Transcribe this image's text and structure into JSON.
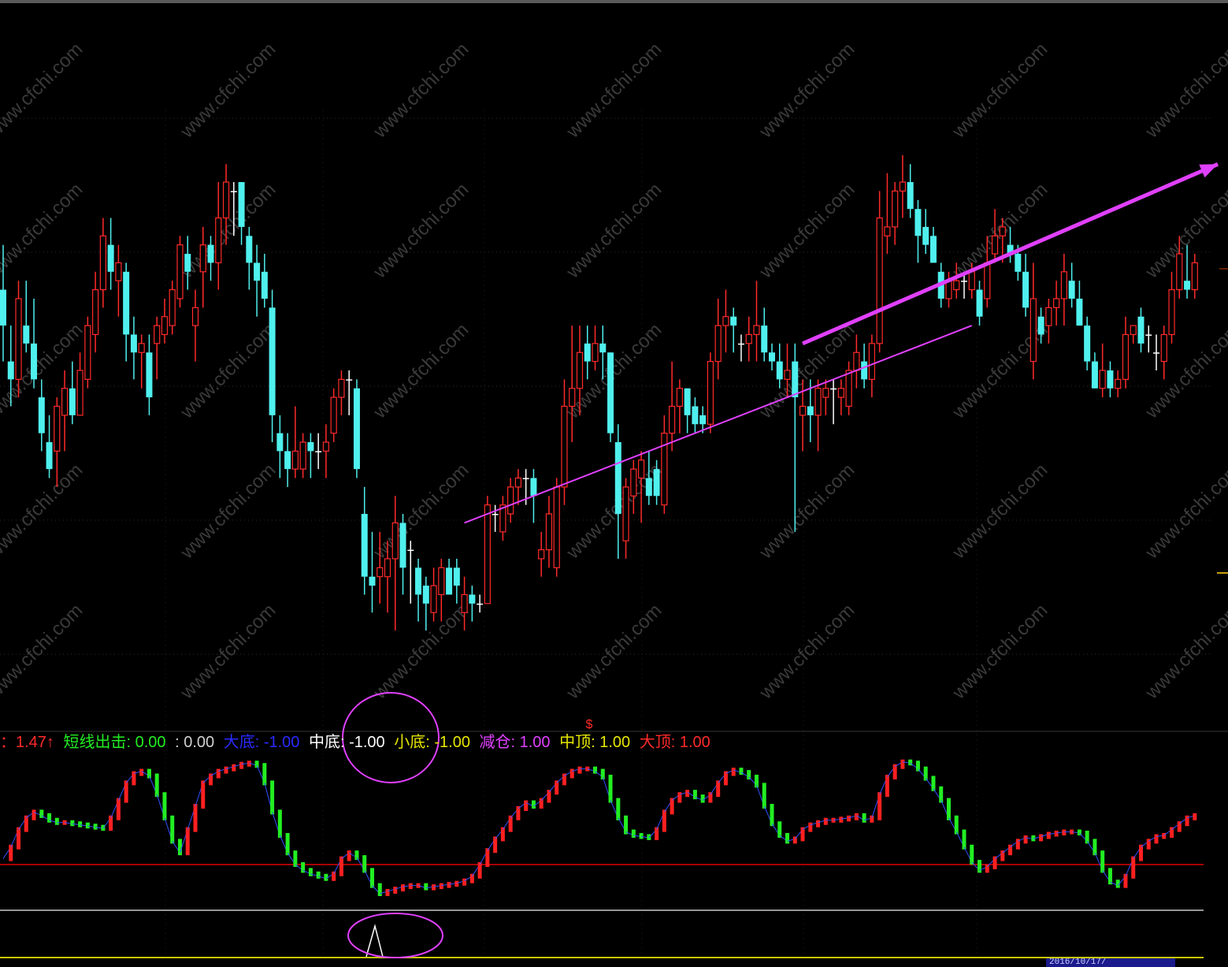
{
  "colors": {
    "background": "#000000",
    "up_candle": "#ff2a2a",
    "down_candle": "#4ff0ee",
    "flat_candle": "#ffffff",
    "trend_arrow": "#e040ff",
    "circle": "#e040ff",
    "osc_up": "#ff2020",
    "osc_down": "#22ee22",
    "zero_line": "#e00000",
    "divider": "#c8c8c8",
    "bottom_line": "#c8c800",
    "watermark": "#3a3a3a"
  },
  "watermark": "www.cfchi.com",
  "legend": [
    {
      "text": "：1.47↑",
      "color": "#ff2a2a"
    },
    {
      "text": "短线出击: 0.00",
      "color": "#22ee22"
    },
    {
      "text": ": 0.00",
      "color": "#d0d0d0"
    },
    {
      "text": "大底: -1.00",
      "color": "#2a2aff"
    },
    {
      "text": "中底: -1.00",
      "color": "#ffffff"
    },
    {
      "text": "小底: -1.00",
      "color": "#e6e600"
    },
    {
      "text": "减仓: 1.00",
      "color": "#e040ff"
    },
    {
      "text": "中顶: 1.00",
      "color": "#e6e600"
    },
    {
      "text": "大顶: 1.00",
      "color": "#ff2a2a"
    }
  ],
  "signal_mark": "$",
  "date_badge": "2016/10/17/",
  "chart_data": [
    {
      "type": "candlestick",
      "title": "",
      "candles": [
        [
          12.0,
          12.5,
          11.2,
          11.6
        ],
        [
          11.2,
          11.6,
          10.7,
          11.0
        ],
        [
          11.0,
          12.1,
          10.8,
          11.9
        ],
        [
          11.6,
          12.1,
          11.3,
          11.4
        ],
        [
          11.4,
          11.9,
          10.9,
          11.0
        ],
        [
          10.8,
          11.0,
          10.2,
          10.4
        ],
        [
          10.3,
          10.6,
          9.9,
          10.0
        ],
        [
          10.2,
          10.8,
          9.8,
          10.7
        ],
        [
          10.6,
          11.1,
          10.2,
          10.9
        ],
        [
          10.9,
          11.2,
          10.5,
          10.6
        ],
        [
          10.6,
          11.3,
          10.6,
          11.1
        ],
        [
          11.0,
          11.7,
          10.9,
          11.6
        ],
        [
          11.5,
          12.2,
          11.3,
          12.0
        ],
        [
          12.0,
          12.8,
          11.8,
          12.6
        ],
        [
          12.5,
          12.8,
          12.0,
          12.2
        ],
        [
          12.1,
          12.5,
          11.7,
          12.3
        ],
        [
          12.2,
          12.3,
          11.2,
          11.5
        ],
        [
          11.5,
          11.7,
          11.0,
          11.3
        ],
        [
          11.3,
          11.5,
          10.9,
          11.4
        ],
        [
          11.3,
          11.5,
          10.6,
          10.8
        ],
        [
          11.4,
          11.7,
          11.0,
          11.6
        ],
        [
          11.5,
          11.9,
          11.4,
          11.7
        ],
        [
          11.6,
          12.1,
          11.5,
          12.0
        ],
        [
          11.9,
          12.6,
          11.8,
          12.5
        ],
        [
          12.4,
          12.6,
          12.0,
          12.2
        ],
        [
          11.6,
          12.0,
          11.2,
          11.8
        ],
        [
          12.2,
          12.7,
          11.8,
          12.5
        ],
        [
          12.5,
          12.6,
          12.1,
          12.3
        ],
        [
          12.3,
          13.2,
          12.0,
          12.8
        ],
        [
          12.8,
          13.4,
          12.5,
          13.2
        ],
        [
          13.1,
          13.2,
          12.6,
          13.1
        ],
        [
          13.2,
          13.2,
          12.5,
          12.7
        ],
        [
          12.6,
          12.7,
          12.0,
          12.3
        ],
        [
          12.3,
          12.5,
          11.7,
          12.1
        ],
        [
          12.2,
          12.4,
          11.8,
          11.9
        ],
        [
          11.8,
          12.0,
          10.3,
          10.6
        ],
        [
          10.4,
          10.6,
          9.9,
          10.2
        ],
        [
          10.2,
          10.4,
          9.8,
          10.0
        ],
        [
          10.0,
          10.7,
          9.9,
          10.2
        ],
        [
          10.0,
          10.4,
          9.9,
          10.3
        ],
        [
          10.3,
          10.4,
          9.9,
          10.2
        ],
        [
          10.2,
          10.4,
          10.0,
          10.2
        ],
        [
          10.2,
          10.5,
          9.9,
          10.3
        ],
        [
          10.4,
          10.9,
          10.3,
          10.8
        ],
        [
          10.8,
          11.1,
          10.6,
          11.0
        ],
        [
          11.0,
          11.1,
          10.6,
          11.0
        ],
        [
          10.9,
          11.0,
          9.9,
          10.0
        ],
        [
          9.5,
          9.8,
          8.6,
          8.8
        ],
        [
          8.8,
          9.3,
          8.4,
          8.7
        ],
        [
          8.8,
          9.3,
          8.5,
          8.9
        ],
        [
          8.8,
          9.2,
          8.4,
          9.0
        ],
        [
          9.0,
          9.7,
          8.2,
          9.4
        ],
        [
          9.4,
          9.5,
          8.6,
          8.9
        ],
        [
          9.1,
          9.2,
          8.5,
          9.1
        ],
        [
          8.9,
          9.0,
          8.3,
          8.6
        ],
        [
          8.7,
          8.8,
          8.2,
          8.5
        ],
        [
          8.4,
          8.9,
          8.3,
          8.7
        ],
        [
          8.6,
          9.0,
          8.3,
          8.9
        ],
        [
          8.9,
          9.0,
          8.6,
          8.6
        ],
        [
          8.9,
          9.0,
          8.5,
          8.7
        ],
        [
          8.4,
          8.8,
          8.2,
          8.6
        ],
        [
          8.6,
          8.7,
          8.3,
          8.5
        ],
        [
          8.5,
          8.6,
          8.4,
          8.5
        ],
        [
          8.5,
          9.7,
          8.5,
          9.6
        ],
        [
          9.5,
          9.6,
          9.3,
          9.5
        ],
        [
          9.3,
          9.7,
          9.2,
          9.6
        ],
        [
          9.5,
          9.9,
          9.4,
          9.8
        ],
        [
          9.8,
          10.0,
          9.6,
          9.9
        ],
        [
          9.9,
          10.0,
          9.6,
          9.9
        ],
        [
          9.9,
          10.0,
          9.4,
          9.7
        ],
        [
          9.0,
          9.3,
          8.8,
          9.1
        ],
        [
          9.1,
          9.7,
          8.9,
          9.5
        ],
        [
          8.9,
          9.9,
          8.8,
          9.8
        ],
        [
          9.8,
          11.0,
          9.6,
          10.7
        ],
        [
          10.7,
          11.6,
          10.3,
          10.9
        ],
        [
          10.9,
          11.6,
          10.6,
          11.3
        ],
        [
          11.4,
          11.6,
          11.0,
          11.2
        ],
        [
          11.2,
          11.6,
          11.1,
          11.4
        ],
        [
          11.4,
          11.6,
          11.0,
          11.3
        ],
        [
          11.3,
          11.3,
          10.3,
          10.4
        ],
        [
          10.3,
          10.5,
          9.0,
          9.5
        ],
        [
          9.2,
          9.9,
          9.0,
          9.8
        ],
        [
          9.7,
          10.1,
          9.5,
          10.0
        ],
        [
          9.9,
          10.2,
          9.4,
          10.1
        ],
        [
          9.9,
          10.2,
          9.6,
          9.7
        ],
        [
          10.0,
          10.1,
          9.6,
          9.7
        ],
        [
          9.6,
          10.6,
          9.5,
          10.4
        ],
        [
          10.4,
          11.2,
          10.2,
          10.7
        ],
        [
          10.7,
          11.0,
          10.4,
          10.9
        ],
        [
          10.9,
          10.9,
          10.4,
          10.6
        ],
        [
          10.7,
          10.8,
          10.4,
          10.5
        ],
        [
          10.6,
          10.7,
          10.4,
          10.5
        ],
        [
          10.5,
          11.3,
          10.4,
          11.2
        ],
        [
          11.2,
          11.9,
          11.0,
          11.6
        ],
        [
          11.6,
          12.0,
          11.3,
          11.7
        ],
        [
          11.7,
          11.8,
          11.3,
          11.6
        ],
        [
          11.4,
          11.5,
          11.2,
          11.4
        ],
        [
          11.4,
          11.7,
          11.2,
          11.5
        ],
        [
          11.5,
          12.1,
          11.2,
          11.6
        ],
        [
          11.6,
          11.8,
          11.2,
          11.3
        ],
        [
          11.3,
          11.4,
          11.1,
          11.2
        ],
        [
          11.2,
          11.4,
          10.9,
          11.0
        ],
        [
          11.0,
          11.4,
          10.8,
          11.1
        ],
        [
          11.2,
          11.4,
          9.3,
          10.8
        ],
        [
          10.6,
          11.0,
          10.2,
          10.7
        ],
        [
          10.7,
          11.0,
          10.3,
          10.6
        ],
        [
          10.6,
          11.0,
          10.2,
          10.9
        ],
        [
          10.8,
          11.0,
          10.6,
          10.9
        ],
        [
          10.9,
          11.0,
          10.5,
          10.9
        ],
        [
          10.8,
          11.0,
          10.6,
          10.9
        ],
        [
          10.7,
          11.2,
          10.6,
          11.1
        ],
        [
          11.1,
          11.5,
          10.9,
          11.3
        ],
        [
          11.2,
          11.4,
          10.9,
          11.0
        ],
        [
          11.0,
          11.5,
          10.8,
          11.4
        ],
        [
          11.4,
          13.1,
          11.3,
          12.8
        ],
        [
          12.6,
          13.3,
          12.4,
          12.7
        ],
        [
          12.7,
          13.2,
          12.5,
          13.1
        ],
        [
          13.1,
          13.5,
          12.8,
          13.2
        ],
        [
          13.2,
          13.4,
          12.8,
          12.9
        ],
        [
          12.9,
          13.0,
          12.3,
          12.6
        ],
        [
          12.7,
          12.9,
          12.4,
          12.5
        ],
        [
          12.6,
          12.7,
          12.3,
          12.3
        ],
        [
          12.2,
          12.3,
          11.8,
          11.9
        ],
        [
          11.9,
          12.2,
          11.8,
          12.1
        ],
        [
          12.0,
          12.3,
          11.9,
          12.1
        ],
        [
          12.1,
          12.2,
          11.9,
          12.1
        ],
        [
          12.0,
          12.3,
          11.9,
          12.2
        ],
        [
          12.0,
          12.1,
          11.6,
          11.7
        ],
        [
          11.9,
          12.6,
          11.8,
          12.3
        ],
        [
          12.4,
          12.9,
          12.3,
          12.6
        ],
        [
          12.6,
          12.8,
          12.3,
          12.7
        ],
        [
          12.5,
          12.7,
          12.3,
          12.4
        ],
        [
          12.4,
          12.5,
          12.1,
          12.2
        ],
        [
          12.2,
          12.4,
          11.7,
          11.8
        ],
        [
          11.2,
          12.3,
          11.0,
          11.9
        ],
        [
          11.7,
          11.8,
          11.4,
          11.5
        ],
        [
          11.6,
          11.9,
          11.4,
          11.8
        ],
        [
          11.8,
          12.1,
          11.6,
          11.9
        ],
        [
          11.9,
          12.4,
          11.6,
          12.2
        ],
        [
          12.1,
          12.3,
          11.8,
          11.9
        ],
        [
          11.9,
          12.1,
          11.6,
          11.6
        ],
        [
          11.6,
          11.7,
          11.1,
          11.2
        ],
        [
          11.2,
          11.3,
          10.9,
          10.9
        ],
        [
          10.9,
          11.4,
          10.8,
          11.1
        ],
        [
          11.1,
          11.2,
          10.8,
          10.9
        ],
        [
          10.9,
          11.1,
          10.8,
          11.0
        ],
        [
          11.0,
          11.7,
          10.9,
          11.5
        ],
        [
          11.5,
          11.6,
          11.4,
          11.6
        ],
        [
          11.7,
          11.8,
          11.3,
          11.4
        ],
        [
          11.5,
          11.6,
          11.3,
          11.5
        ],
        [
          11.3,
          11.5,
          11.1,
          11.3
        ],
        [
          11.2,
          11.6,
          11.0,
          11.5
        ],
        [
          11.5,
          12.2,
          11.4,
          12.0
        ],
        [
          12.0,
          12.6,
          11.9,
          12.4
        ],
        [
          12.1,
          12.5,
          11.9,
          12.0
        ],
        [
          12.0,
          12.4,
          11.9,
          12.3
        ]
      ],
      "annotations": [
        {
          "type": "arrow",
          "from": [
            60,
            9.4
          ],
          "to": [
            126,
            11.6
          ]
        },
        {
          "type": "arrow",
          "from": [
            104,
            11.4
          ],
          "to": [
            158,
            13.4
          ]
        }
      ]
    },
    {
      "type": "line",
      "title": "",
      "zero_value": 0,
      "values": [
        0.05,
        0.15,
        0.3,
        0.4,
        0.45,
        0.42,
        0.38,
        0.36,
        0.36,
        0.35,
        0.34,
        0.33,
        0.32,
        0.31,
        0.4,
        0.55,
        0.7,
        0.78,
        0.8,
        0.76,
        0.6,
        0.4,
        0.2,
        0.1,
        0.3,
        0.5,
        0.7,
        0.76,
        0.8,
        0.82,
        0.84,
        0.86,
        0.87,
        0.85,
        0.7,
        0.45,
        0.25,
        0.1,
        0.0,
        -0.05,
        -0.08,
        -0.1,
        -0.12,
        -0.08,
        0.05,
        0.1,
        0.06,
        -0.05,
        -0.18,
        -0.25,
        -0.23,
        -0.21,
        -0.19,
        -0.18,
        -0.18,
        -0.2,
        -0.19,
        -0.18,
        -0.17,
        -0.16,
        -0.14,
        -0.1,
        0.0,
        0.12,
        0.22,
        0.3,
        0.4,
        0.48,
        0.53,
        0.5,
        0.55,
        0.62,
        0.7,
        0.76,
        0.8,
        0.82,
        0.82,
        0.8,
        0.75,
        0.55,
        0.4,
        0.28,
        0.25,
        0.24,
        0.23,
        0.3,
        0.45,
        0.55,
        0.6,
        0.62,
        0.58,
        0.55,
        0.6,
        0.7,
        0.78,
        0.81,
        0.79,
        0.75,
        0.68,
        0.5,
        0.35,
        0.25,
        0.2,
        0.22,
        0.3,
        0.34,
        0.36,
        0.38,
        0.38,
        0.39,
        0.4,
        0.42,
        0.38,
        0.4,
        0.6,
        0.75,
        0.84,
        0.88,
        0.87,
        0.82,
        0.74,
        0.65,
        0.55,
        0.4,
        0.28,
        0.15,
        0.02,
        -0.05,
        -0.02,
        0.05,
        0.1,
        0.15,
        0.2,
        0.23,
        0.22,
        0.24,
        0.26,
        0.27,
        0.28,
        0.28,
        0.27,
        0.2,
        0.1,
        -0.05,
        -0.15,
        -0.18,
        -0.1,
        0.05,
        0.15,
        0.2,
        0.24,
        0.25,
        0.3,
        0.35,
        0.4,
        0.42
      ]
    }
  ]
}
